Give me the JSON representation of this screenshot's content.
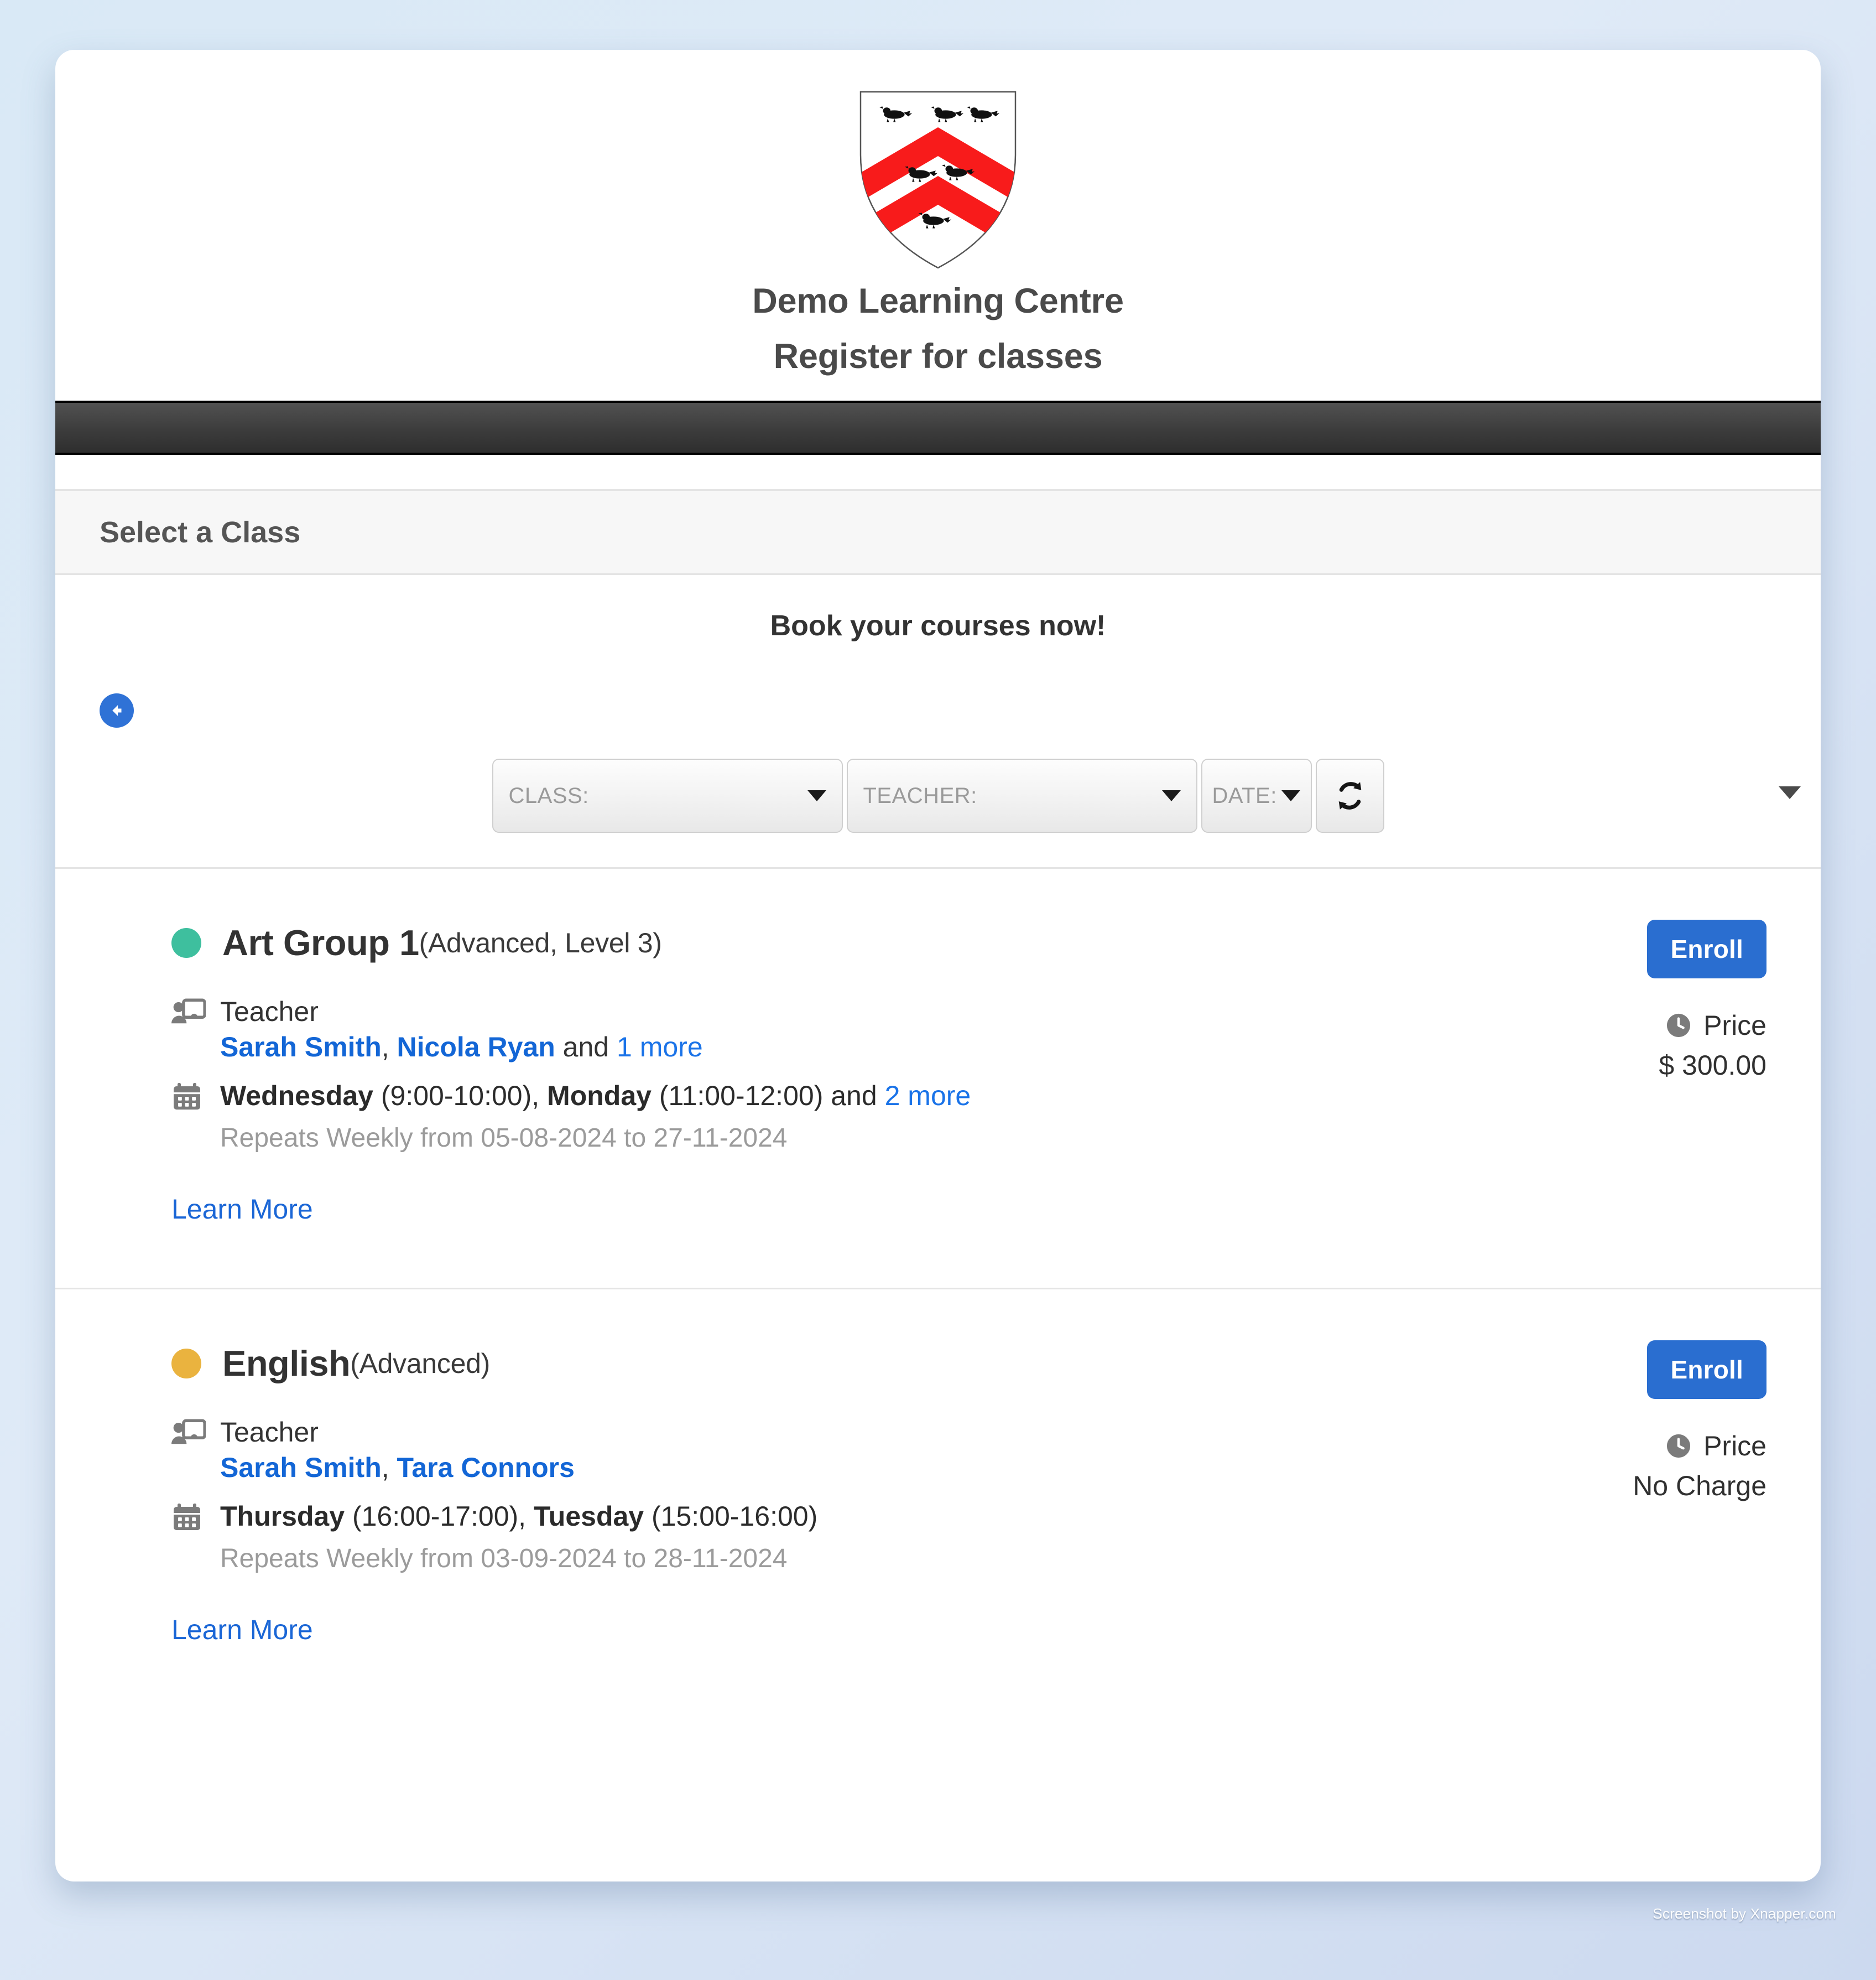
{
  "brand": {
    "crest_icon": "shield-crest-icon",
    "title": "Demo Learning Centre",
    "subtitle": "Register for classes"
  },
  "panel": {
    "heading": "Select a Class",
    "intro": "Book your courses now!"
  },
  "back_button": {
    "icon": "arrow-left-icon"
  },
  "filters": {
    "class": {
      "label": "CLASS:",
      "icon": "chevron-down-icon"
    },
    "teacher": {
      "label": "TEACHER:",
      "icon": "chevron-down-icon"
    },
    "date": {
      "label": "DATE:",
      "icon": "chevron-down-icon"
    },
    "refresh": {
      "icon": "refresh-icon"
    },
    "overflow": {
      "icon": "chevron-down-icon"
    }
  },
  "labels": {
    "teacher": "Teacher",
    "price": "Price",
    "learn_more": "Learn More",
    "enroll": "Enroll",
    "and": "and"
  },
  "colors": {
    "accent_blue": "#2a6ed0",
    "link_blue": "#1a66d6",
    "dot_green": "#3ebf9e",
    "dot_amber": "#eab33f",
    "navbar": "#3c3c3c"
  },
  "classes": [
    {
      "dot_color": "#3ebf9e",
      "name": "Art Group 1",
      "meta": "(Advanced, Level 3)",
      "teacher_label": "Teacher",
      "teachers": [
        "Sarah Smith",
        "Nicola Ryan"
      ],
      "teachers_more": "1 more",
      "schedule": [
        {
          "day": "Wednesday",
          "time": "(9:00-10:00)"
        },
        {
          "day": "Monday",
          "time": "(11:00-12:00)"
        }
      ],
      "schedule_more": "2 more",
      "repeats": "Repeats Weekly from 05-08-2024 to 27-11-2024",
      "learn_more": "Learn More",
      "enroll": "Enroll",
      "price_label": "Price",
      "price_value": "$ 300.00"
    },
    {
      "dot_color": "#eab33f",
      "name": "English",
      "meta": "(Advanced)",
      "teacher_label": "Teacher",
      "teachers": [
        "Sarah Smith",
        "Tara Connors"
      ],
      "teachers_more": "",
      "schedule": [
        {
          "day": "Thursday",
          "time": "(16:00-17:00)"
        },
        {
          "day": "Tuesday",
          "time": "(15:00-16:00)"
        }
      ],
      "schedule_more": "",
      "repeats": "Repeats Weekly from 03-09-2024 to 28-11-2024",
      "learn_more": "Learn More",
      "enroll": "Enroll",
      "price_label": "Price",
      "price_value": "No Charge"
    }
  ],
  "watermark": "Screenshot by Xnapper.com"
}
